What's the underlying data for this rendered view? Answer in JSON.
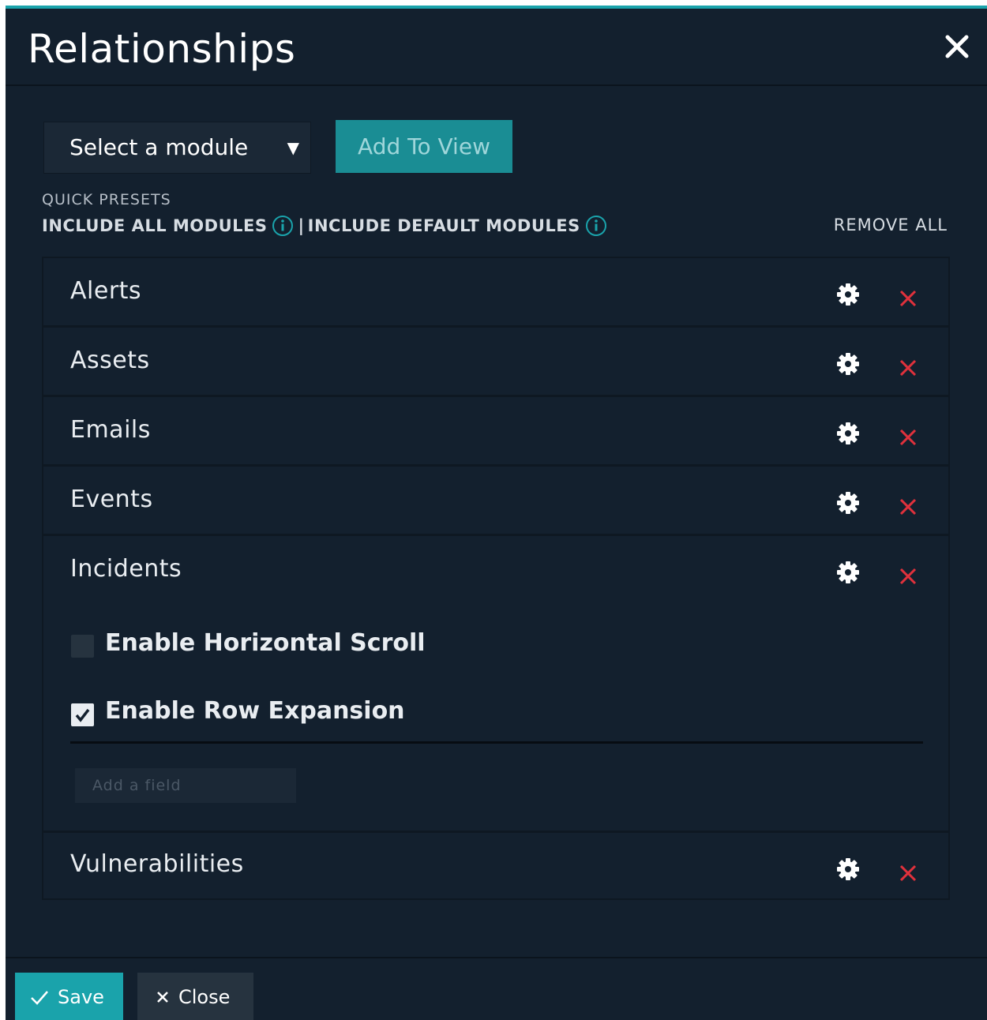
{
  "dialog": {
    "title": "Relationships"
  },
  "toolbar": {
    "module_select_value": "Select a module",
    "add_to_view_label": "Add To View"
  },
  "quick_presets": {
    "label": "QUICK PRESETS",
    "include_all": "INCLUDE ALL MODULES",
    "separator": "|",
    "include_default": "INCLUDE DEFAULT MODULES",
    "remove_all": "REMOVE ALL"
  },
  "modules": [
    {
      "label": "Alerts"
    },
    {
      "label": "Assets"
    },
    {
      "label": "Emails"
    },
    {
      "label": "Events"
    },
    {
      "label": "Incidents"
    },
    {
      "label": "Vulnerabilities"
    }
  ],
  "incidents_options": {
    "horizontal_scroll": {
      "label": "Enable Horizontal Scroll",
      "checked": false
    },
    "row_expansion": {
      "label": "Enable Row Expansion",
      "checked": true
    },
    "add_field_placeholder": "Add a field"
  },
  "footer": {
    "save_label": "Save",
    "close_label": "Close"
  },
  "colors": {
    "accent": "#1aa3ab",
    "background": "#13202e",
    "delete": "#e0313c"
  },
  "icons": {
    "close": "close-icon",
    "info": "info-icon",
    "settings": "gear-icon",
    "delete": "delete-icon",
    "save": "checkmark-icon"
  }
}
